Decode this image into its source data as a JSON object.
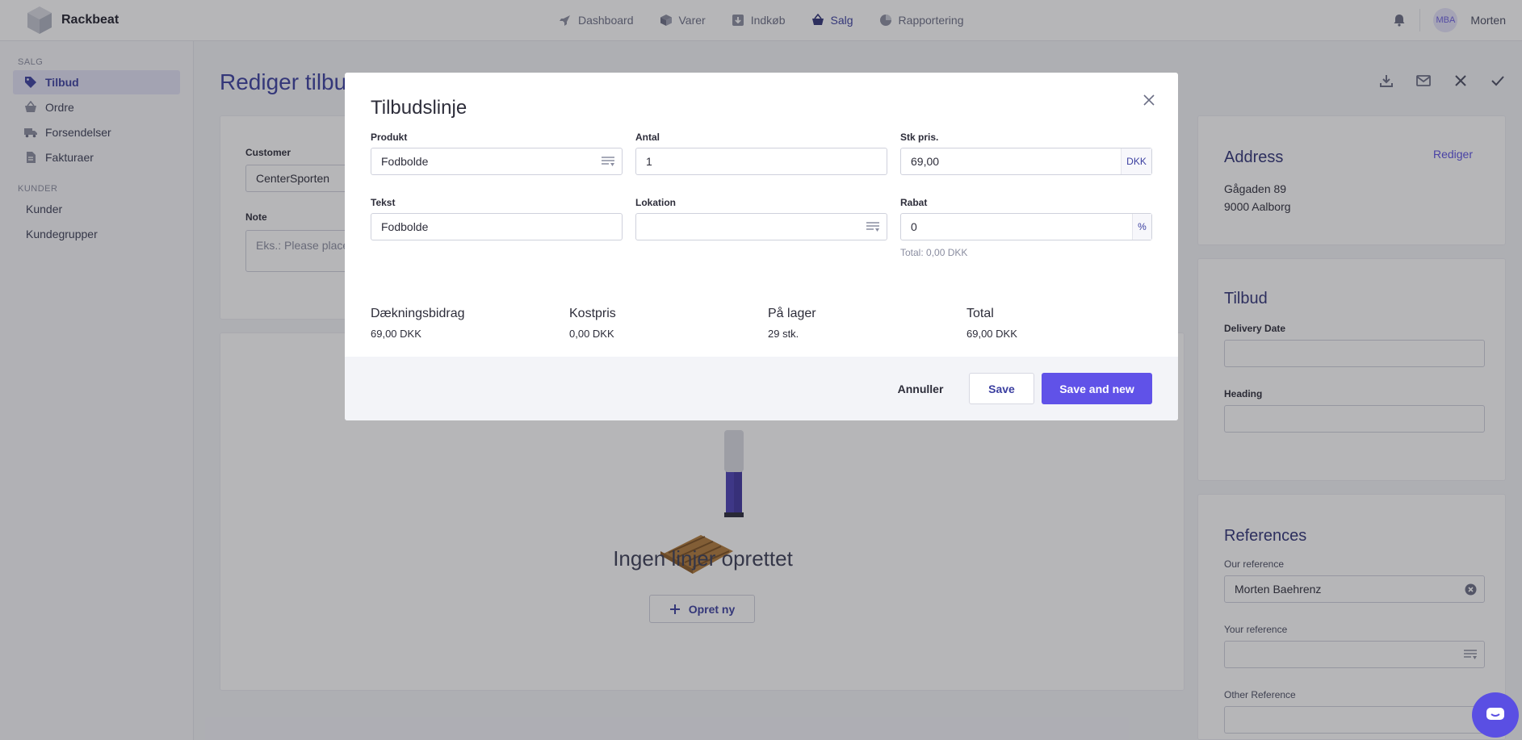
{
  "brand": {
    "name": "Rackbeat"
  },
  "topnav": [
    {
      "label": "Dashboard",
      "icon": "rocket-icon"
    },
    {
      "label": "Varer",
      "icon": "box-icon"
    },
    {
      "label": "Indkøb",
      "icon": "download-box-icon"
    },
    {
      "label": "Salg",
      "icon": "basket-icon",
      "active": true
    },
    {
      "label": "Rapportering",
      "icon": "pie-chart-icon"
    }
  ],
  "user": {
    "initials": "MBA",
    "name": "Morten"
  },
  "sidebar": {
    "section_salg": "SALG",
    "salg_items": [
      {
        "label": "Tilbud",
        "icon": "tag-icon",
        "active": true
      },
      {
        "label": "Ordre",
        "icon": "basket-icon"
      },
      {
        "label": "Forsendelser",
        "icon": "truck-icon"
      },
      {
        "label": "Fakturaer",
        "icon": "document-icon"
      }
    ],
    "section_kunder": "KUNDER",
    "kunder_items": [
      {
        "label": "Kunder"
      },
      {
        "label": "Kundegrupper"
      }
    ]
  },
  "page": {
    "title": "Rediger tilbud",
    "customer_label": "Customer",
    "customer_value": "CenterSporten",
    "note_label": "Note",
    "note_placeholder": "Eks.: Please place",
    "empty_title": "Ingen linjer oprettet",
    "create_new": "Opret ny"
  },
  "address": {
    "title": "Address",
    "edit": "Rediger",
    "line1": "Gågaden 89",
    "line2": "9000 Aalborg"
  },
  "tilbud_card": {
    "title": "Tilbud",
    "delivery_label": "Delivery Date",
    "heading_label": "Heading"
  },
  "references": {
    "title": "References",
    "our_label": "Our reference",
    "our_value": "Morten Baehrenz",
    "your_label": "Your reference",
    "other_label": "Other Reference"
  },
  "modal": {
    "title": "Tilbudslinje",
    "produkt_label": "Produkt",
    "produkt_value": "Fodbolde",
    "antal_label": "Antal",
    "antal_value": "1",
    "stk_label": "Stk pris.",
    "stk_value": "69,00",
    "stk_suffix": "DKK",
    "tekst_label": "Tekst",
    "tekst_value": "Fodbolde",
    "lokation_label": "Lokation",
    "lokation_value": "",
    "rabat_label": "Rabat",
    "rabat_value": "0",
    "rabat_suffix": "%",
    "total_hint": "Total: 0,00 DKK",
    "stats": [
      {
        "label": "Dækningsbidrag",
        "value": "69,00 DKK"
      },
      {
        "label": "Kostpris",
        "value": "0,00 DKK"
      },
      {
        "label": "På lager",
        "value": "29 stk."
      },
      {
        "label": "Total",
        "value": "69,00 DKK"
      }
    ],
    "cancel": "Annuller",
    "save": "Save",
    "save_new": "Save and new"
  },
  "colors": {
    "accent": "#6052e8",
    "nav_active": "#3b3fa0"
  }
}
